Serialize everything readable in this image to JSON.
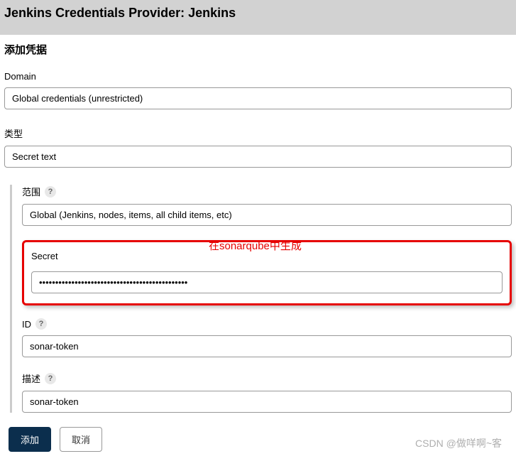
{
  "header": {
    "title": "Jenkins Credentials Provider: Jenkins"
  },
  "section_title": "添加凭据",
  "domain": {
    "label": "Domain",
    "value": "Global credentials (unrestricted)"
  },
  "type": {
    "label": "类型",
    "value": "Secret text"
  },
  "scope": {
    "label": "范围",
    "value": "Global (Jenkins, nodes, items, all child items, etc)"
  },
  "secret": {
    "label": "Secret",
    "value": "••••••••••••••••••••••••••••••••••••••••••••••"
  },
  "annotation": "在sonarqube中生成",
  "id": {
    "label": "ID",
    "value": "sonar-token"
  },
  "description": {
    "label": "描述",
    "value": "sonar-token"
  },
  "buttons": {
    "add": "添加",
    "cancel": "取消"
  },
  "help": "?",
  "watermark": "CSDN @做咩啊~客"
}
